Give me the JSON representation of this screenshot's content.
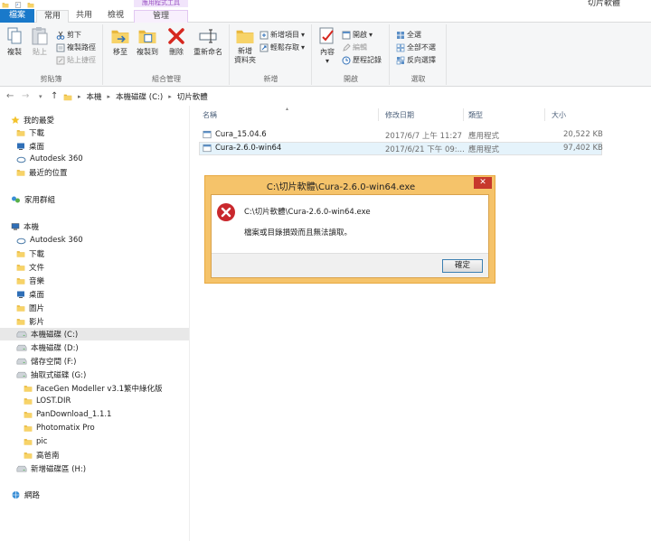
{
  "window": {
    "title": "切片軟體",
    "context_tab_label": "應用程式工具"
  },
  "tabs": [
    {
      "label": "檔案"
    },
    {
      "label": "常用"
    },
    {
      "label": "共用"
    },
    {
      "label": "檢視"
    },
    {
      "label": "管理"
    }
  ],
  "ribbon": {
    "clipboard": {
      "copy": "複製",
      "paste": "貼上",
      "cut": "剪下",
      "copy_path": "複製路徑",
      "paste_shortcut": "貼上捷徑",
      "label": "剪貼簿"
    },
    "organize": {
      "move_to": "移至",
      "copy_to": "複製到",
      "delete": "刪除",
      "rename": "重新命名",
      "label": "組合管理"
    },
    "new": {
      "new_folder_line1": "新增",
      "new_folder_line2": "資料夾",
      "new_item": "新增項目",
      "easy_access": "輕鬆存取",
      "label": "新增"
    },
    "open": {
      "properties": "內容",
      "open": "開啟",
      "edit": "編輯",
      "history": "歷程記錄",
      "label": "開啟"
    },
    "select": {
      "select_all": "全選",
      "select_none": "全部不選",
      "invert": "反向選擇",
      "label": "選取"
    }
  },
  "address": {
    "crumbs": [
      "本機",
      "本機磁碟 (C:)",
      "切片軟體"
    ]
  },
  "nav": {
    "favorites": "我的最愛",
    "downloads": "下載",
    "desktop": "桌面",
    "autodesk": "Autodesk 360",
    "recent": "最近的位置",
    "homegroup": "家用群組",
    "this_pc": "本機",
    "pc_autodesk": "Autodesk 360",
    "pc_downloads": "下載",
    "pc_documents": "文件",
    "pc_music": "音樂",
    "pc_desktop": "桌面",
    "pc_pictures": "圖片",
    "pc_videos": "影片",
    "drive_c": "本機磁碟 (C:)",
    "drive_d": "本機磁碟 (D:)",
    "drive_f": "儲存空間 (F:)",
    "drive_g": "抽取式磁碟 (G:)",
    "g_folders": [
      "FaceGen Modeller v3.1繁中綠化版",
      "LOST.DIR",
      "PanDownload_1.1.1",
      "Photomatix Pro",
      "pic",
      "高爸南"
    ],
    "drive_h": "新增磁碟區 (H:)",
    "network": "網路"
  },
  "columns": {
    "name": "名稱",
    "date": "修改日期",
    "type": "類型",
    "size": "大小"
  },
  "files": [
    {
      "name": "Cura_15.04.6",
      "date": "2017/6/7 上午 11:27",
      "type": "應用程式",
      "size": "20,522 KB"
    },
    {
      "name": "Cura-2.6.0-win64",
      "date": "2017/6/21 下午 09:...",
      "type": "應用程式",
      "size": "97,402 KB"
    }
  ],
  "dialog": {
    "title": "C:\\切片軟體\\Cura-2.6.0-win64.exe",
    "path": "C:\\切片軟體\\Cura-2.6.0-win64.exe",
    "message": "檔案或目錄損毀而且無法讀取。",
    "ok": "確定"
  },
  "colors": {
    "file_tab": "#1979ca",
    "dialog_frame": "#f5c36a",
    "close_button": "#c7382c",
    "error_icon": "#c9282d",
    "folder": "#e8b73c"
  }
}
